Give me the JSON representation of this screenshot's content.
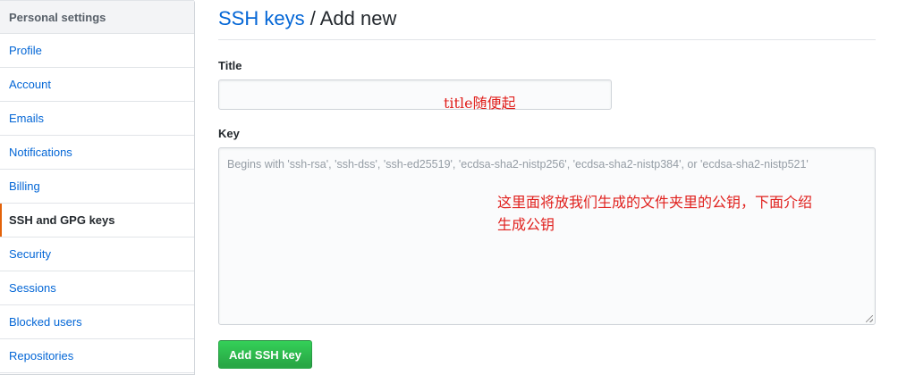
{
  "sidebar": {
    "header": "Personal settings",
    "items": [
      {
        "label": "Profile"
      },
      {
        "label": "Account"
      },
      {
        "label": "Emails"
      },
      {
        "label": "Notifications"
      },
      {
        "label": "Billing"
      },
      {
        "label": "SSH and GPG keys",
        "selected": true
      },
      {
        "label": "Security"
      },
      {
        "label": "Sessions"
      },
      {
        "label": "Blocked users"
      },
      {
        "label": "Repositories"
      }
    ]
  },
  "main": {
    "breadcrumb_link": "SSH keys",
    "breadcrumb_separator": " / ",
    "breadcrumb_current": "Add new",
    "title_label": "Title",
    "title_value": "",
    "key_label": "Key",
    "key_placeholder": "Begins with 'ssh-rsa', 'ssh-dss', 'ssh-ed25519', 'ecdsa-sha2-nistp256', 'ecdsa-sha2-nistp384', or 'ecdsa-sha2-nistp521'",
    "submit_label": "Add SSH key"
  },
  "annotations": {
    "title_note": "title随便起",
    "key_note_line1": "这里面将放我们生成的文件夹里的公钥，下面介绍",
    "key_note_line2": "生成公钥"
  },
  "colors": {
    "link": "#0366d6",
    "selected_marker": "#e36209",
    "button": "#28a745",
    "annotation": "#e0201d"
  }
}
